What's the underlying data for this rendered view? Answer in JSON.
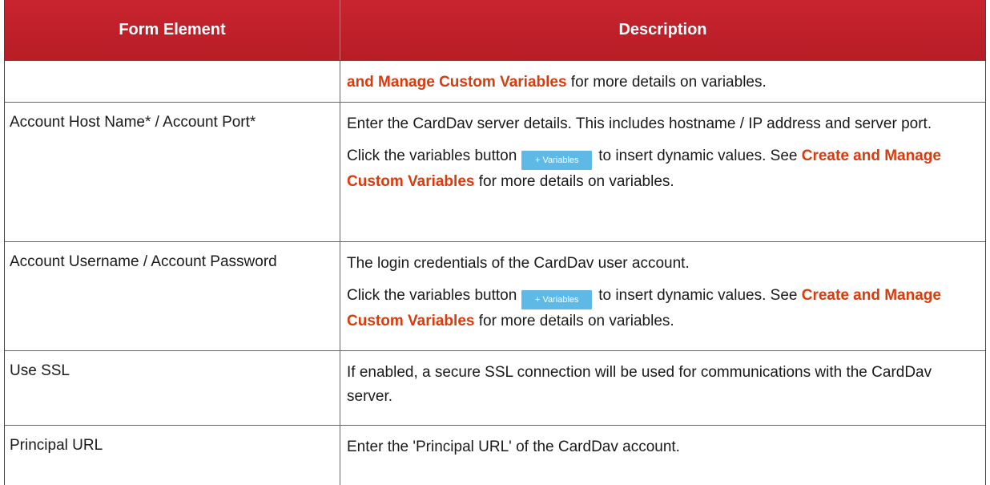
{
  "header": {
    "col1": "Form Element",
    "col2": "Description"
  },
  "variables_button": "+ Variables",
  "rows": [
    {
      "element": "",
      "link": "and Manage Custom Variables",
      "after": " for more details on variables."
    },
    {
      "element": "Account Host Name* / Account Port*",
      "desc1": "Enter the CardDav server details. This includes hostname / IP address and server port.",
      "p2_before": "Click the variables button",
      "p2_mid": "to insert dynamic values. See ",
      "p2_link": "Create and Manage Custom Variables",
      "p2_after": " for more details on variables."
    },
    {
      "element": "Account Username / Account Password",
      "desc1": "The login credentials of the CardDav user account.",
      "p2_before": "Click the variables button",
      "p2_mid": "to insert dynamic values. See ",
      "p2_link": "Create and Manage Custom Variables",
      "p2_after": " for more details on variables."
    },
    {
      "element": "Use SSL",
      "desc1": "If enabled, a secure SSL connection will be used for communications with the CardDav server."
    },
    {
      "element": "Principal URL",
      "desc1": "Enter the 'Principal URL' of the CardDav account."
    }
  ]
}
